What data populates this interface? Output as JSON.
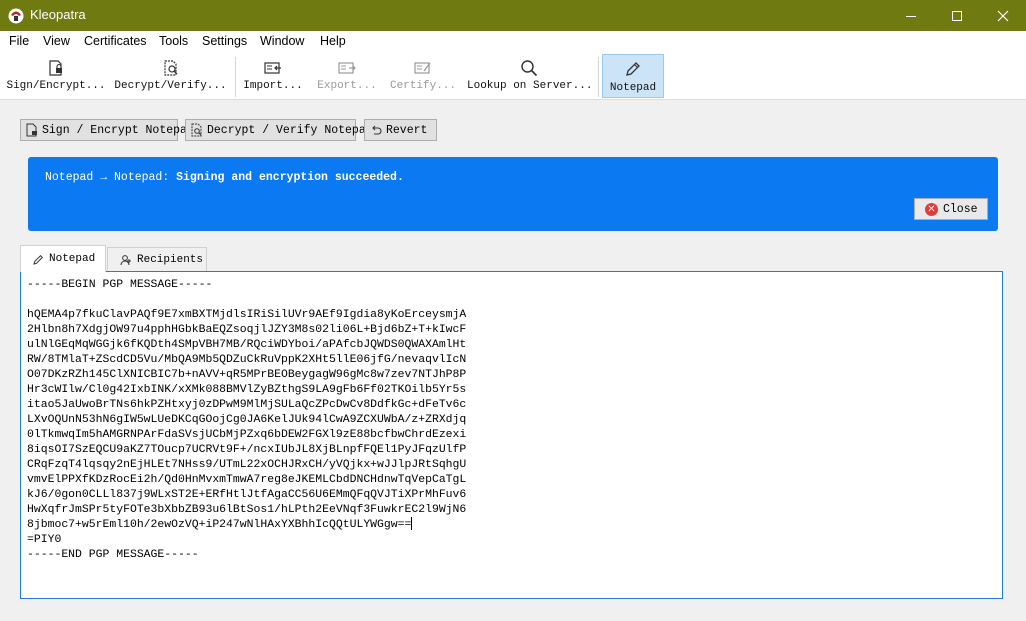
{
  "window": {
    "title": "Kleopatra"
  },
  "menu": [
    "File",
    "View",
    "Certificates",
    "Tools",
    "Settings",
    "Window",
    "Help"
  ],
  "toolbar": {
    "sign_encrypt": "Sign/Encrypt...",
    "decrypt_verify": "Decrypt/Verify...",
    "import": "Import...",
    "export": "Export...",
    "certify": "Certify...",
    "lookup": "Lookup on Server...",
    "notepad": "Notepad"
  },
  "panel": {
    "sign_encrypt_btn": "Sign / Encrypt Notepad",
    "decrypt_verify_btn": "Decrypt / Verify Notepad",
    "revert_btn": "Revert"
  },
  "banner": {
    "prefix": "Notepad → Notepad: ",
    "message": "Signing and encryption succeeded.",
    "close": "Close",
    "bg_color": "#0a79f2"
  },
  "tabs": {
    "notepad": "Notepad",
    "recipients": "Recipients"
  },
  "editor": {
    "lines": [
      "-----BEGIN PGP MESSAGE-----",
      "",
      "hQEMA4p7fkuClavPAQf9E7xmBXTMjdlsIRiSilUVr9AEf9Igdia8yKoErceysmjA",
      "2Hlbn8h7XdgjOW97u4pphHGbkBaEQZsoqjlJZY3M8s02li06L+Bjd6bZ+T+kIwcF",
      "ulNlGEqMqWGGjk6fKQDth4SMpVBH7MB/RQciWDYboi/aPAfcbJQWDS0QWAXAmlHt",
      "RW/8TMlaT+ZScdCD5Vu/MbQA9Mb5QDZuCkRuVppK2XHt5llE06jfG/nevaqvlIcN",
      "O07DKzRZh145ClXNICBIC7b+nAVV+qR5MPrBEOBeygagW96gMc8w7zev7NTJhP8P",
      "Hr3cWIlw/Cl0g42IxbINK/xXMk088BMVlZyBZthgS9LA9gFb6Ff02TKOilb5Yr5s",
      "itao5JaUwoBrTNs6hkPZHtxyj0zDPwM9MlMjSULaQcZPcDwCv8DdfkGc+dFeTv6c",
      "LXvOQUnN53hN6gIW5wLUeDKCqGOojCg0JA6KelJUk94lCwA9ZCXUWbA/z+ZRXdjq",
      "0lTkmwqIm5hAMGRNPArFdaSVsjUCbMjPZxq6bDEW2FGXl9zE88bcfbwChrdEzexi",
      "8iqsOI7SzEQCU9aKZ7TOucp7UCRVt9F+/ncxIUbJL8XjBLnpfFQEl1PyJFqzUlfP",
      "CRqFzqT4lqsqy2nEjHLEt7NHss9/UTmL22xOCHJRxCH/yVQjkx+wJJlpJRtSqhgU",
      "vmvElPPXfKDzRocEi2h/Qd0HnMvxmTmwA7reg8eJKEMLCbdDNCHdnwTqVepCaTgL",
      "kJ6/0gon0CLLl837j9WLxST2E+ERfHtlJtfAgaCC56U6EMmQFqQVJTiXPrMhFuv6",
      "HwXqfrJmSPr5tyFOTe3bXbbZB93u6lBtSos1/hLPth2EeVNqf3FuwkrEC2l9WjN6",
      "8jbmoc7+w5rEml10h/2ewOzVQ+iP247wNlHAxYXBhhIcQQtULYWGgw==",
      "=PIY0",
      "-----END PGP MESSAGE-----"
    ]
  }
}
